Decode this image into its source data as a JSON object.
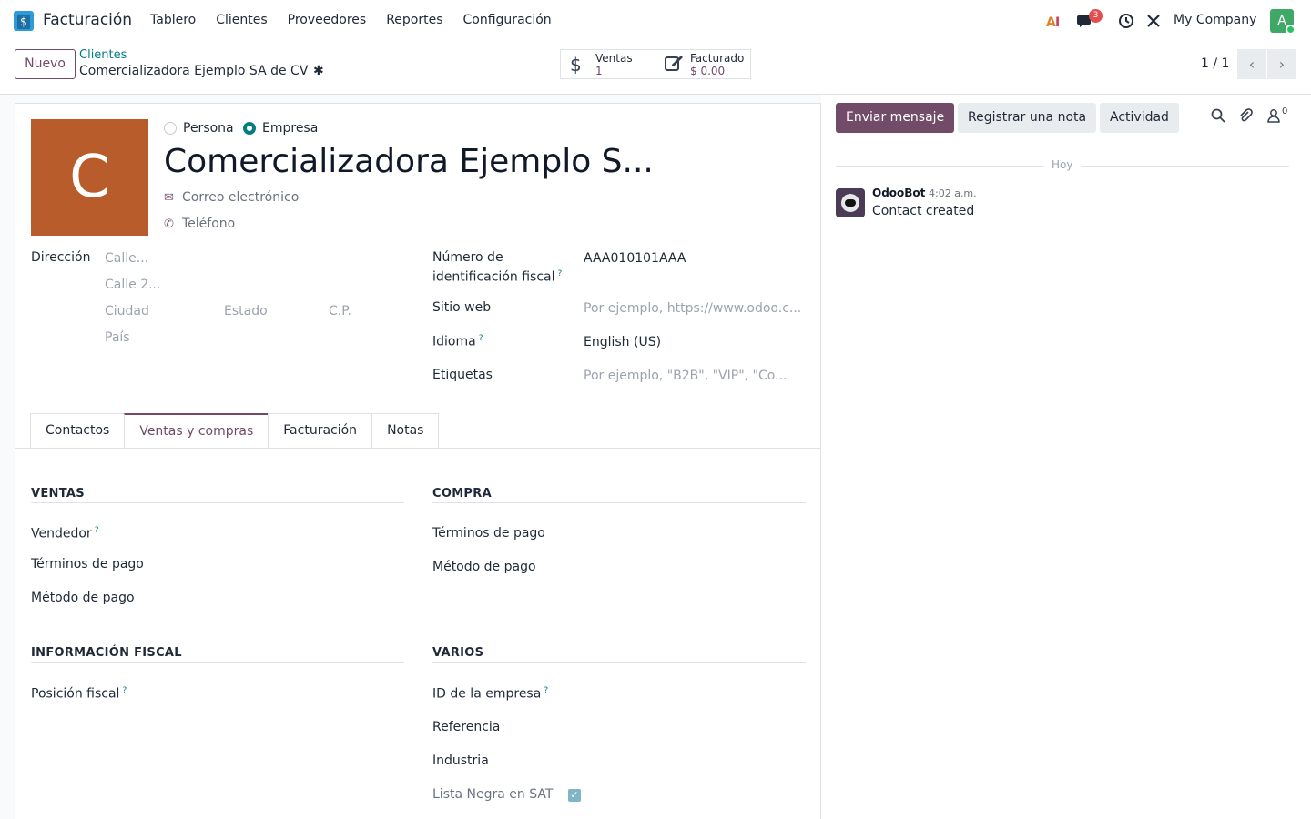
{
  "navbar": {
    "app_name": "Facturación",
    "menu": [
      "Tablero",
      "Clientes",
      "Proveedores",
      "Reportes",
      "Configuración"
    ],
    "messages_count": "3",
    "company": "My Company",
    "avatar_letter": "A"
  },
  "control": {
    "new_label": "Nuevo",
    "breadcrumb_parent": "Clientes",
    "breadcrumb_current": "Comercializadora Ejemplo SA de CV",
    "smart_buttons": [
      {
        "label": "Ventas",
        "value": "1",
        "icon": "dollar-icon"
      },
      {
        "label": "Facturado",
        "value": "$ 0.00",
        "icon": "invoice-edit-icon"
      }
    ],
    "pager": "1 / 1"
  },
  "form": {
    "photo_letter": "C",
    "type_options": [
      "Persona",
      "Empresa"
    ],
    "selected_type": "Empresa",
    "name": "Comercializadora Ejemplo S...",
    "email_placeholder": "Correo electrónico",
    "phone_placeholder": "Teléfono",
    "address_label": "Dirección",
    "address": {
      "street": "Calle...",
      "street2": "Calle 2...",
      "city": "Ciudad",
      "state": "Estado",
      "zip": "C.P.",
      "country": "País"
    },
    "vat_label_1": "Número de",
    "vat_label_2": "identificación fiscal",
    "vat_value": "AAA010101AAA",
    "website_label": "Sitio web",
    "website_placeholder": "Por ejemplo, https://www.odoo.c...",
    "language_label": "Idioma",
    "language_value": "English (US)",
    "tags_label": "Etiquetas",
    "tags_placeholder": "Por ejemplo, \"B2B\", \"VIP\", \"Co...",
    "help_mark": "?"
  },
  "tabs": [
    "Contactos",
    "Ventas y compras",
    "Facturación",
    "Notas"
  ],
  "active_tab": "Ventas y compras",
  "sections": {
    "ventas": {
      "title": "VENTAS",
      "fields": [
        "Vendedor",
        "Términos de pago",
        "Método de pago"
      ]
    },
    "compra": {
      "title": "COMPRA",
      "fields": [
        "Términos de pago",
        "Método de pago"
      ]
    },
    "fiscal": {
      "title": "INFORMACIÓN FISCAL",
      "fields": [
        "Posición fiscal"
      ]
    },
    "varios": {
      "title": "VARIOS",
      "fields": [
        "ID de la empresa",
        "Referencia",
        "Industria",
        "Lista Negra en SAT"
      ]
    }
  },
  "chatter": {
    "send_message": "Enviar mensaje",
    "log_note": "Registrar una nota",
    "activity": "Actividad",
    "followers_count": "0",
    "date_separator": "Hoy",
    "messages": [
      {
        "author": "OdooBot",
        "time": "4:02 a.m.",
        "body": "Contact created"
      }
    ]
  },
  "colors": {
    "primary": "#714b67",
    "teal": "#017e84",
    "avatar_bg": "#b85c2c"
  }
}
